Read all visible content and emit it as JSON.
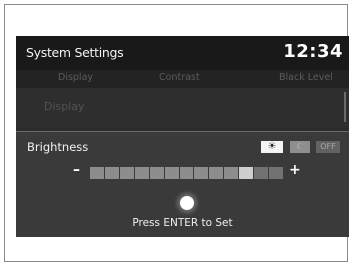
{
  "header": {
    "title": "System Settings",
    "clock": "12:34"
  },
  "tabs": [
    {
      "label": "Display"
    },
    {
      "label": "Contrast"
    },
    {
      "label": "Black Level"
    }
  ],
  "background_item": {
    "label": "Display"
  },
  "brightness_panel": {
    "title": "Brightness",
    "modes": [
      {
        "name": "sun-icon",
        "label": "☀",
        "active": true
      },
      {
        "name": "moon-icon",
        "label": "☾",
        "active": false
      },
      {
        "name": "off",
        "label": "OFF",
        "active": false
      }
    ],
    "decrease_label": "–",
    "increase_label": "+",
    "level": {
      "current": 11,
      "max": 13
    },
    "hint": "Press ENTER to Set"
  },
  "colors": {
    "screen_bg": "#2b2b2b",
    "title_bar_bg": "#191919",
    "panel_bg": "#3a3a3a",
    "text": "#f2f2f2"
  }
}
